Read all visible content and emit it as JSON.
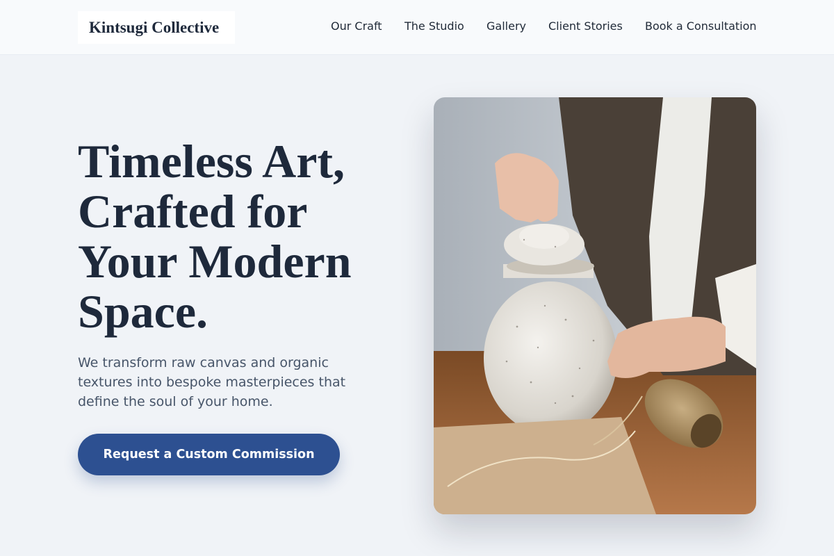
{
  "header": {
    "logo": "Kintsugi Collective",
    "nav": [
      "Our Craft",
      "The Studio",
      "Gallery",
      "Client Stories",
      "Book a Consultation"
    ]
  },
  "hero": {
    "title_lines": [
      "Timeless Art,",
      "Crafted for",
      "Your Modern",
      "Space."
    ],
    "subtitle_lines": [
      "We transform raw canvas and organic",
      "textures into bespoke masterpieces that",
      "define the soul of your home."
    ],
    "cta_label": "Request a Custom Commission"
  },
  "image": {
    "subject": "hands lifting lid of speckled ceramic jar beside twine spool on wooden table"
  },
  "colors": {
    "background": "#f0f3f7",
    "header": "#f8fafc",
    "heading": "#1e293b",
    "body_text": "#475569",
    "accent": "#2d5091"
  }
}
